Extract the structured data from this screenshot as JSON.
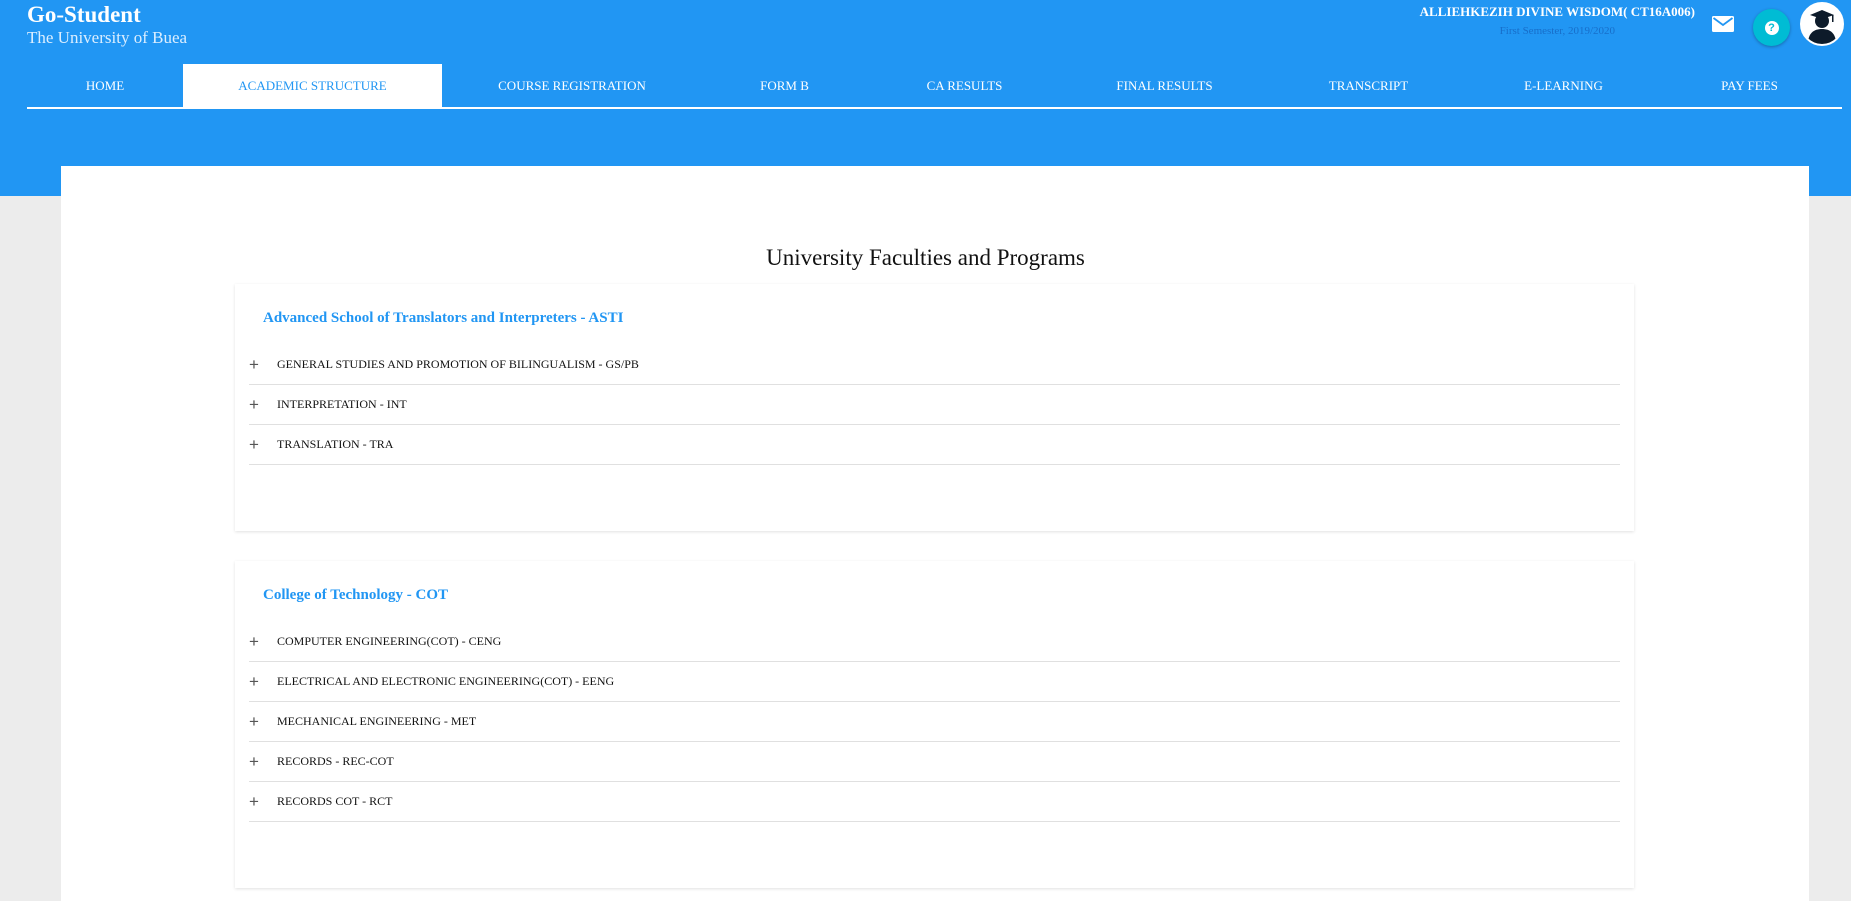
{
  "brand": {
    "title": "Go-Student",
    "subtitle": "The University of Buea"
  },
  "user": {
    "name": "ALLIEHKEZIH DIVINE WISDOM( CT16A006)",
    "semester": "First Semester, 2019/2020"
  },
  "header_icons": {
    "mail": "mail-icon",
    "help": "help-icon",
    "help_glyph": "?",
    "avatar": "graduate-avatar"
  },
  "nav": {
    "active": "ACADEMIC STRUCTURE",
    "items": [
      {
        "label": "HOME"
      },
      {
        "label": "ACADEMIC STRUCTURE"
      },
      {
        "label": "COURSE REGISTRATION"
      },
      {
        "label": "FORM B"
      },
      {
        "label": "CA RESULTS"
      },
      {
        "label": "FINAL RESULTS"
      },
      {
        "label": "TRANSCRIPT"
      },
      {
        "label": "E-LEARNING"
      },
      {
        "label": "PAY FEES"
      }
    ]
  },
  "main": {
    "title": "University Faculties and Programs",
    "expand_glyph": "+",
    "faculties": [
      {
        "title": "Advanced School of Translators and Interpreters - ASTI",
        "departments": [
          "GENERAL STUDIES AND PROMOTION OF BILINGUALISM - GS/PB",
          "INTERPRETATION - INT",
          "TRANSLATION - TRA"
        ]
      },
      {
        "title": "College of Technology - COT",
        "departments": [
          "COMPUTER ENGINEERING(COT) - CENG",
          "ELECTRICAL AND ELECTRONIC ENGINEERING(COT) - EENG",
          "MECHANICAL ENGINEERING - MET",
          "RECORDS - REC-COT",
          "RECORDS COT - RCT"
        ]
      }
    ]
  },
  "colors": {
    "primary": "#2196f3",
    "help_button": "#00bcd4",
    "background": "#ececec"
  }
}
